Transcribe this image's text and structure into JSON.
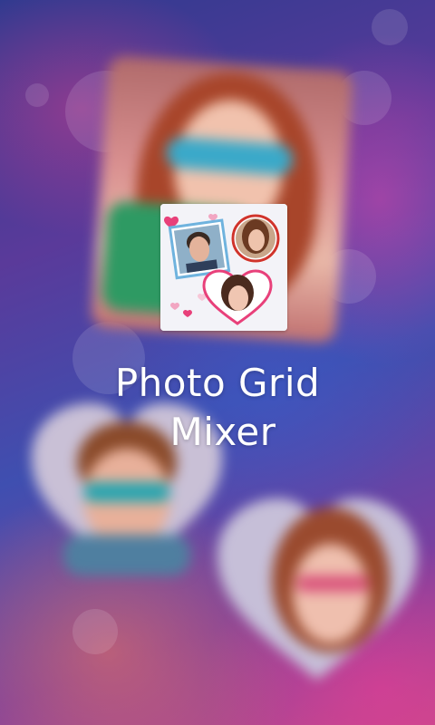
{
  "splash": {
    "title_line1": "Photo Grid",
    "title_line2": "Mixer"
  },
  "icon": {
    "name": "photo-grid-mixer-app-icon"
  },
  "colors": {
    "title_text": "#ffffff",
    "background_primary": "#3f4fb0",
    "background_accent": "#c24a8a",
    "heart_accent": "#e8407a",
    "frame_red": "#d0342c"
  }
}
